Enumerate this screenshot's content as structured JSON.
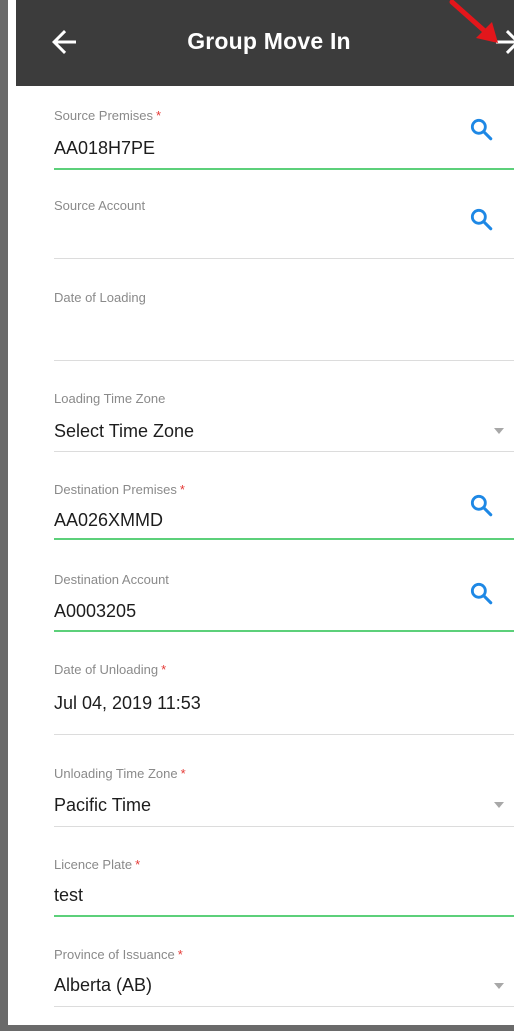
{
  "appbar": {
    "title": "Group Move In",
    "back_icon": "arrow-left-icon",
    "next_icon": "arrow-right-icon"
  },
  "colors": {
    "appbar_bg": "#3c3c3c",
    "accent_search": "#1e88e5",
    "active_underline": "#5cd07a",
    "required": "#e53935"
  },
  "form": {
    "source_premises": {
      "label": "Source Premises",
      "required": "*",
      "value": "AA018H7PE"
    },
    "source_account": {
      "label": "Source Account",
      "value": ""
    },
    "date_of_loading": {
      "label": "Date of Loading",
      "value": ""
    },
    "loading_time_zone": {
      "label": "Loading Time Zone",
      "value": "Select Time Zone"
    },
    "destination_premises": {
      "label": "Destination Premises",
      "required": "*",
      "value": "AA026XMMD"
    },
    "destination_account": {
      "label": "Destination Account",
      "value": "A0003205"
    },
    "date_of_unloading": {
      "label": "Date of Unloading",
      "required": "*",
      "value": "Jul 04, 2019 11:53"
    },
    "unloading_time_zone": {
      "label": "Unloading Time Zone",
      "required": "*",
      "value": "Pacific Time"
    },
    "licence_plate": {
      "label": "Licence Plate",
      "required": "*",
      "value": "test"
    },
    "province_of_issuance": {
      "label": "Province of Issuance",
      "required": "*",
      "value": "Alberta (AB)"
    }
  }
}
